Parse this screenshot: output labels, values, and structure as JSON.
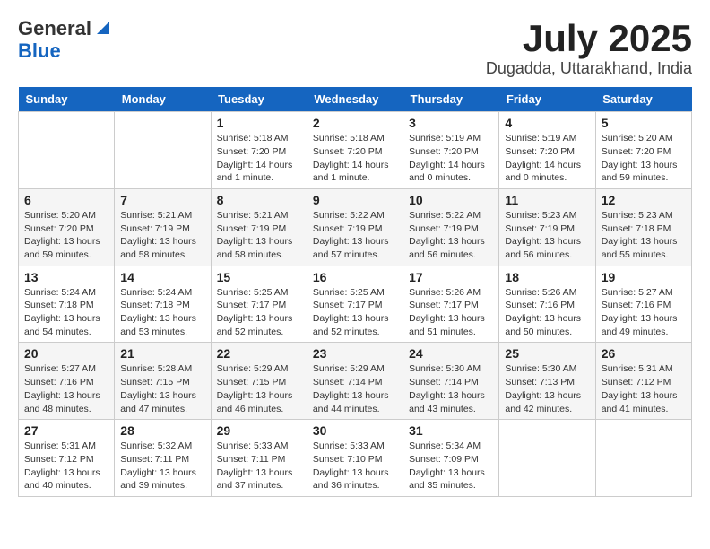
{
  "header": {
    "logo_line1": "General",
    "logo_line2": "Blue",
    "month_year": "July 2025",
    "location": "Dugadda, Uttarakhand, India"
  },
  "weekdays": [
    "Sunday",
    "Monday",
    "Tuesday",
    "Wednesday",
    "Thursday",
    "Friday",
    "Saturday"
  ],
  "weeks": [
    [
      {
        "day": "",
        "info": ""
      },
      {
        "day": "",
        "info": ""
      },
      {
        "day": "1",
        "info": "Sunrise: 5:18 AM\nSunset: 7:20 PM\nDaylight: 14 hours\nand 1 minute."
      },
      {
        "day": "2",
        "info": "Sunrise: 5:18 AM\nSunset: 7:20 PM\nDaylight: 14 hours\nand 1 minute."
      },
      {
        "day": "3",
        "info": "Sunrise: 5:19 AM\nSunset: 7:20 PM\nDaylight: 14 hours\nand 0 minutes."
      },
      {
        "day": "4",
        "info": "Sunrise: 5:19 AM\nSunset: 7:20 PM\nDaylight: 14 hours\nand 0 minutes."
      },
      {
        "day": "5",
        "info": "Sunrise: 5:20 AM\nSunset: 7:20 PM\nDaylight: 13 hours\nand 59 minutes."
      }
    ],
    [
      {
        "day": "6",
        "info": "Sunrise: 5:20 AM\nSunset: 7:20 PM\nDaylight: 13 hours\nand 59 minutes."
      },
      {
        "day": "7",
        "info": "Sunrise: 5:21 AM\nSunset: 7:19 PM\nDaylight: 13 hours\nand 58 minutes."
      },
      {
        "day": "8",
        "info": "Sunrise: 5:21 AM\nSunset: 7:19 PM\nDaylight: 13 hours\nand 58 minutes."
      },
      {
        "day": "9",
        "info": "Sunrise: 5:22 AM\nSunset: 7:19 PM\nDaylight: 13 hours\nand 57 minutes."
      },
      {
        "day": "10",
        "info": "Sunrise: 5:22 AM\nSunset: 7:19 PM\nDaylight: 13 hours\nand 56 minutes."
      },
      {
        "day": "11",
        "info": "Sunrise: 5:23 AM\nSunset: 7:19 PM\nDaylight: 13 hours\nand 56 minutes."
      },
      {
        "day": "12",
        "info": "Sunrise: 5:23 AM\nSunset: 7:18 PM\nDaylight: 13 hours\nand 55 minutes."
      }
    ],
    [
      {
        "day": "13",
        "info": "Sunrise: 5:24 AM\nSunset: 7:18 PM\nDaylight: 13 hours\nand 54 minutes."
      },
      {
        "day": "14",
        "info": "Sunrise: 5:24 AM\nSunset: 7:18 PM\nDaylight: 13 hours\nand 53 minutes."
      },
      {
        "day": "15",
        "info": "Sunrise: 5:25 AM\nSunset: 7:17 PM\nDaylight: 13 hours\nand 52 minutes."
      },
      {
        "day": "16",
        "info": "Sunrise: 5:25 AM\nSunset: 7:17 PM\nDaylight: 13 hours\nand 52 minutes."
      },
      {
        "day": "17",
        "info": "Sunrise: 5:26 AM\nSunset: 7:17 PM\nDaylight: 13 hours\nand 51 minutes."
      },
      {
        "day": "18",
        "info": "Sunrise: 5:26 AM\nSunset: 7:16 PM\nDaylight: 13 hours\nand 50 minutes."
      },
      {
        "day": "19",
        "info": "Sunrise: 5:27 AM\nSunset: 7:16 PM\nDaylight: 13 hours\nand 49 minutes."
      }
    ],
    [
      {
        "day": "20",
        "info": "Sunrise: 5:27 AM\nSunset: 7:16 PM\nDaylight: 13 hours\nand 48 minutes."
      },
      {
        "day": "21",
        "info": "Sunrise: 5:28 AM\nSunset: 7:15 PM\nDaylight: 13 hours\nand 47 minutes."
      },
      {
        "day": "22",
        "info": "Sunrise: 5:29 AM\nSunset: 7:15 PM\nDaylight: 13 hours\nand 46 minutes."
      },
      {
        "day": "23",
        "info": "Sunrise: 5:29 AM\nSunset: 7:14 PM\nDaylight: 13 hours\nand 44 minutes."
      },
      {
        "day": "24",
        "info": "Sunrise: 5:30 AM\nSunset: 7:14 PM\nDaylight: 13 hours\nand 43 minutes."
      },
      {
        "day": "25",
        "info": "Sunrise: 5:30 AM\nSunset: 7:13 PM\nDaylight: 13 hours\nand 42 minutes."
      },
      {
        "day": "26",
        "info": "Sunrise: 5:31 AM\nSunset: 7:12 PM\nDaylight: 13 hours\nand 41 minutes."
      }
    ],
    [
      {
        "day": "27",
        "info": "Sunrise: 5:31 AM\nSunset: 7:12 PM\nDaylight: 13 hours\nand 40 minutes."
      },
      {
        "day": "28",
        "info": "Sunrise: 5:32 AM\nSunset: 7:11 PM\nDaylight: 13 hours\nand 39 minutes."
      },
      {
        "day": "29",
        "info": "Sunrise: 5:33 AM\nSunset: 7:11 PM\nDaylight: 13 hours\nand 37 minutes."
      },
      {
        "day": "30",
        "info": "Sunrise: 5:33 AM\nSunset: 7:10 PM\nDaylight: 13 hours\nand 36 minutes."
      },
      {
        "day": "31",
        "info": "Sunrise: 5:34 AM\nSunset: 7:09 PM\nDaylight: 13 hours\nand 35 minutes."
      },
      {
        "day": "",
        "info": ""
      },
      {
        "day": "",
        "info": ""
      }
    ]
  ]
}
